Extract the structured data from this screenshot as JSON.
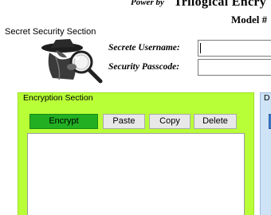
{
  "header": {
    "powered_by": "Power by",
    "brand": "Trilogical Encry",
    "model": "Model #"
  },
  "secret_section": {
    "title": "Secret Security Section",
    "username_label": "Secrete Username:",
    "username_value": "",
    "passcode_label": "Security Passcode:",
    "passcode_value": ""
  },
  "encryption_section": {
    "title": "Encryption Section",
    "buttons": {
      "encrypt": "Encrypt",
      "paste": "Paste",
      "copy": "Copy",
      "delete": "Delete"
    },
    "text": "",
    "color": "#b8ff38",
    "encrypt_color": "#22b022"
  },
  "decryption_section": {
    "title": "D",
    "color": "#cfe3f7"
  },
  "logo": {
    "icon": "spy-magnifier-logo-icon"
  }
}
